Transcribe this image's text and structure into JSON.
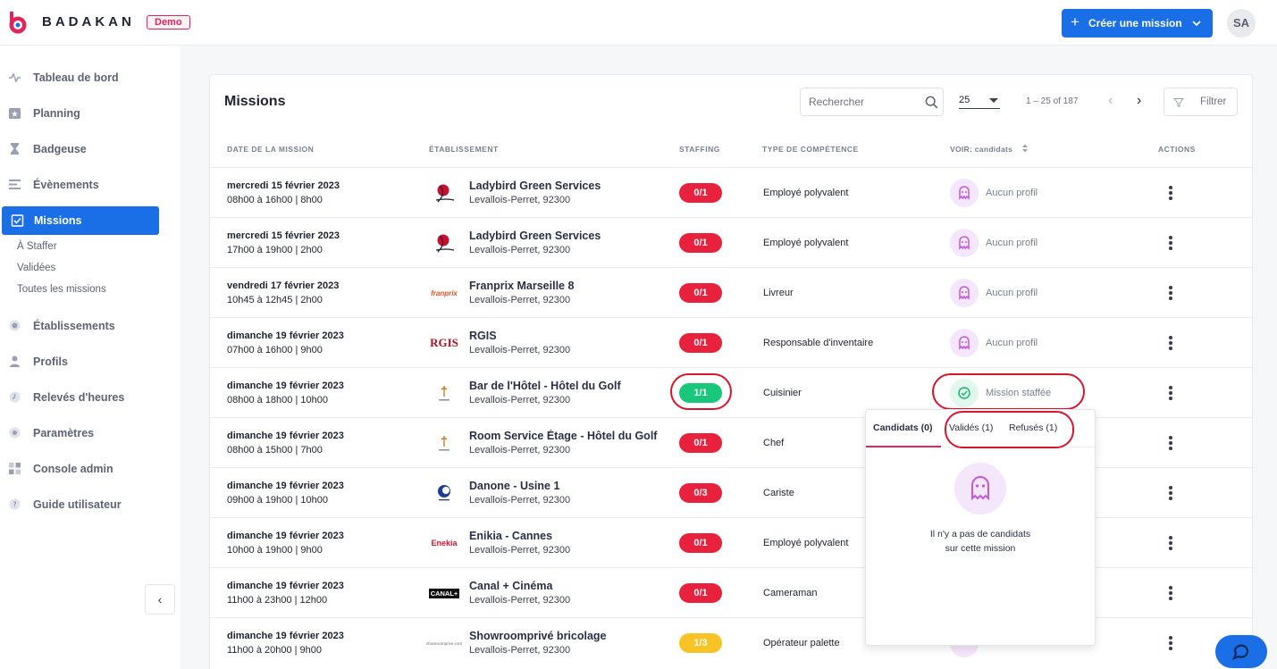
{
  "header": {
    "brand": "BADAKAN",
    "badge": "Demo",
    "create_button": "Créer une mission",
    "avatar_initials": "SA",
    "colors": {
      "brand_red": "#e3245a",
      "primary_blue": "#1a6ee6"
    }
  },
  "sidebar": {
    "items": [
      {
        "label": "Tableau de bord",
        "icon": "pulse-icon"
      },
      {
        "label": "Planning",
        "icon": "calendar-star-icon"
      },
      {
        "label": "Badgeuse",
        "icon": "hourglass-icon"
      },
      {
        "label": "Évènements",
        "icon": "list-icon"
      },
      {
        "label": "Missions",
        "icon": "clipboard-check-icon",
        "active": true
      },
      {
        "label": "Établissements",
        "icon": "building-icon"
      },
      {
        "label": "Profils",
        "icon": "user-icon"
      },
      {
        "label": "Relevés d'heures",
        "icon": "clock-icon"
      },
      {
        "label": "Paramètres",
        "icon": "gear-icon"
      },
      {
        "label": "Console admin",
        "icon": "grid-icon"
      },
      {
        "label": "Guide utilisateur",
        "icon": "help-icon"
      }
    ],
    "sub_items": [
      {
        "label": "À Staffer"
      },
      {
        "label": "Validées"
      },
      {
        "label": "Toutes les missions"
      }
    ],
    "collapse_icon": "chevron-left-icon"
  },
  "missions": {
    "title": "Missions",
    "search_placeholder": "Rechercher",
    "per_page": "25",
    "range": "1 – 25 of 187",
    "filter_label": "Filtrer",
    "columns": {
      "date": "DATE DE LA MISSION",
      "establishment": "ÉTABLISSEMENT",
      "staffing": "STAFFING",
      "competence": "TYPE DE COMPÉTENCE",
      "view": "VOIR: candidats",
      "actions": "ACTIONS"
    },
    "rows": [
      {
        "date": "mercredi 15 février 2023",
        "time": "08h00 à 16h00 | 8h00",
        "logo": "ladybird-logo",
        "name": "Ladybird Green Services",
        "address": "Levallois-Perret, 92300",
        "staffing": "0/1",
        "status": "red",
        "competence": "Employé polyvalent",
        "view": "Aucun profil",
        "view_icon": "ghost-icon"
      },
      {
        "date": "mercredi 15 février 2023",
        "time": "17h00 à 19h00 | 2h00",
        "logo": "ladybird-logo",
        "name": "Ladybird Green Services",
        "address": "Levallois-Perret, 92300",
        "staffing": "0/1",
        "status": "red",
        "competence": "Employé polyvalent",
        "view": "Aucun profil",
        "view_icon": "ghost-icon"
      },
      {
        "date": "vendredi 17 février 2023",
        "time": "10h45 à 12h45 | 2h00",
        "logo": "franprix-logo",
        "logo_text": "franprix",
        "name": "Franprix Marseille 8",
        "address": "Levallois-Perret, 92300",
        "staffing": "0/1",
        "status": "red",
        "competence": "Livreur",
        "view": "Aucun profil",
        "view_icon": "ghost-icon"
      },
      {
        "date": "dimanche 19 février 2023",
        "time": "07h00 à 16h00 | 9h00",
        "logo": "rgis-logo",
        "logo_text": "RGIS",
        "name": "RGIS",
        "address": "Levallois-Perret, 92300",
        "staffing": "0/1",
        "status": "red",
        "competence": "Responsable d'inventaire",
        "view": "Aucun profil",
        "view_icon": "ghost-icon"
      },
      {
        "date": "dimanche 19 février 2023",
        "time": "08h00 à 18h00 | 10h00",
        "logo": "hotel-logo",
        "name": "Bar de l'Hôtel - Hôtel du Golf",
        "address": "Levallois-Perret, 92300",
        "staffing": "1/1",
        "status": "green",
        "competence": "Cuisinier",
        "view": "Mission staffée",
        "view_icon": "check-circle-icon"
      },
      {
        "date": "dimanche 19 février 2023",
        "time": "08h00 à 15h00 | 7h00",
        "logo": "hotel-logo",
        "name": "Room Service Étage - Hôtel du Golf",
        "address": "Levallois-Perret, 92300",
        "staffing": "0/1",
        "status": "red",
        "competence": "Chef",
        "view": "",
        "view_icon": ""
      },
      {
        "date": "dimanche 19 février 2023",
        "time": "09h00 à 19h00 | 10h00",
        "logo": "danone-logo",
        "name": "Danone - Usine 1",
        "address": "Levallois-Perret, 92300",
        "staffing": "0/3",
        "status": "red",
        "competence": "Cariste",
        "view": "",
        "view_icon": ""
      },
      {
        "date": "dimanche 19 février 2023",
        "time": "10h00 à 19h00 | 9h00",
        "logo": "enekia-logo",
        "logo_text": "Enekia",
        "name": "Enikia - Cannes",
        "address": "Levallois-Perret, 92300",
        "staffing": "0/1",
        "status": "red",
        "competence": "Employé polyvalent",
        "view": "",
        "view_icon": ""
      },
      {
        "date": "dimanche 19 février 2023",
        "time": "11h00 à 23h00 | 12h00",
        "logo": "canal-logo",
        "logo_text": "CANAL+",
        "name": "Canal + Cinéma",
        "address": "Levallois-Perret, 92300",
        "staffing": "0/1",
        "status": "red",
        "competence": "Cameraman",
        "view": "",
        "view_icon": ""
      },
      {
        "date": "dimanche 19 février 2023",
        "time": "11h00 à 20h00 | 9h00",
        "logo": "showroom-logo",
        "logo_text": "showroomprive.com",
        "name": "Showroomprivé bricolage",
        "address": "Levallois-Perret, 92300",
        "staffing": "1/3",
        "status": "yellow",
        "competence": "Opérateur palette",
        "view": "",
        "view_icon": ""
      }
    ],
    "status_colors": {
      "red": "#e8213d",
      "green": "#18c77a",
      "yellow": "#f7c325"
    }
  },
  "popup": {
    "tabs": [
      {
        "label": "Candidats (0)",
        "active": true
      },
      {
        "label": "Validés (1)"
      },
      {
        "label": "Refusés (1)"
      }
    ],
    "empty_line1": "Il n'y a pas de candidats",
    "empty_line2": "sur cette mission"
  },
  "chat": {
    "icon": "chat-bubble-icon"
  }
}
